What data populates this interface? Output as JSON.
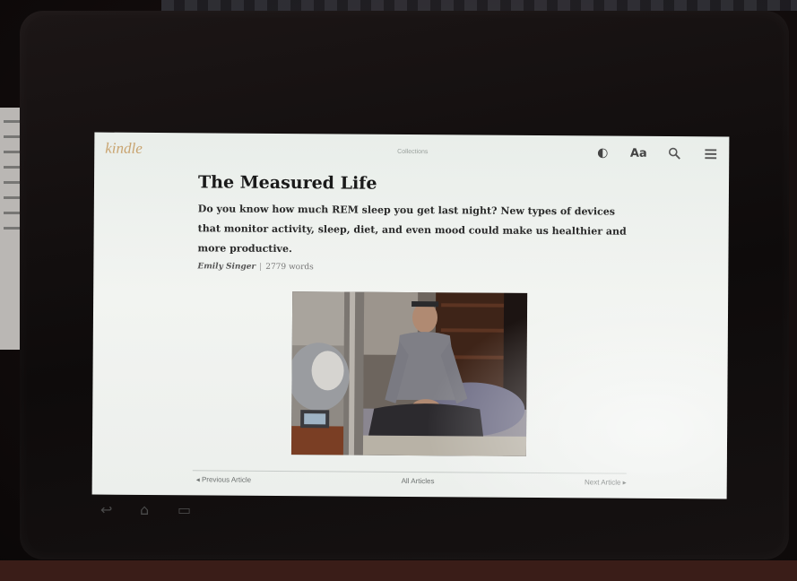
{
  "app": {
    "logo": "kindle",
    "header_title": "Collections"
  },
  "toolbar": {
    "icons": [
      "contrast-icon",
      "font-settings-icon",
      "search-icon",
      "menu-icon"
    ],
    "font_label": "Aa",
    "contrast_glyph": "◐"
  },
  "article": {
    "title": "The Measured Life",
    "deck": "Do you know how much REM sleep you get last night? New types of devices that monitor activity, sleep, diet, and even mood could make us healthier and more productive.",
    "author": "Emily Singer",
    "word_count": "2779 words"
  },
  "nav": {
    "previous": "◂  Previous Article",
    "all": "All Articles",
    "next": "Next Article  ▸"
  },
  "system_bar": {
    "back_glyph": "↩",
    "home_glyph": "⌂",
    "recent_glyph": "▭"
  },
  "colors": {
    "logo": "#c9a470",
    "screen_bg": "#eef1ee",
    "bezel": "#141010"
  }
}
